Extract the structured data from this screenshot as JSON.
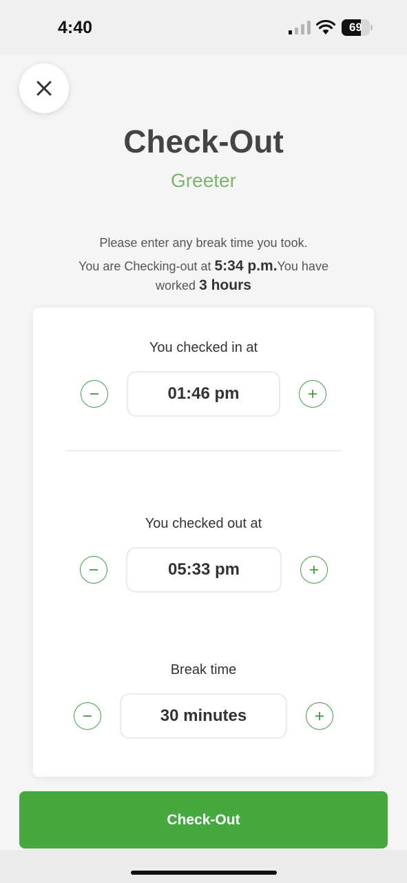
{
  "status_bar": {
    "time": "4:40",
    "battery_level": "69",
    "battery_fraction": 0.69
  },
  "header": {
    "close_icon": "close-icon",
    "title": "Check-Out",
    "role": "Greeter"
  },
  "instructions": {
    "line1": "Please enter any break time you took.",
    "summary_prefix": "You are Checking-out at ",
    "checkout_time": "5:34 p.m.",
    "summary_middle": "You have worked ",
    "worked_hours": "3 hours"
  },
  "form": {
    "checked_in": {
      "label": "You checked in at",
      "value": "01:46 pm"
    },
    "checked_out": {
      "label": "You checked out at",
      "value": "05:33 pm"
    },
    "break_time": {
      "label": "Break time",
      "value": "30 minutes"
    },
    "minus_icon": "minus-circle-icon",
    "plus_icon": "plus-circle-icon"
  },
  "actions": {
    "checkout_label": "Check-Out"
  },
  "colors": {
    "accent": "#46a93f",
    "role_text": "#7ab56a",
    "stepper_border": "#3f9e3f"
  }
}
